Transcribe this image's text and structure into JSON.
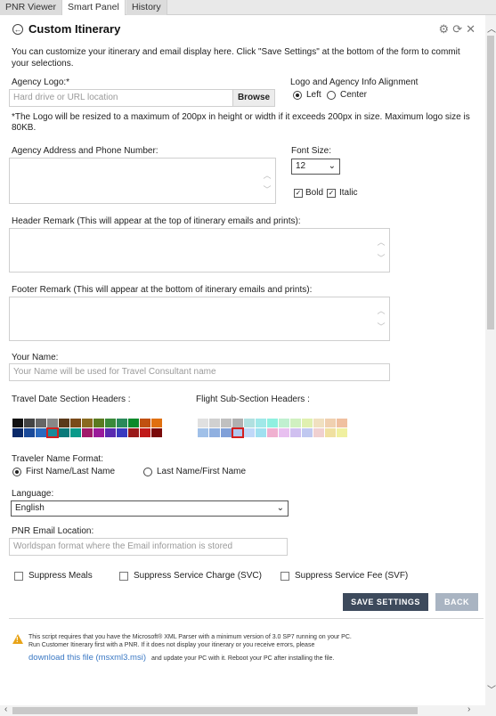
{
  "tabs": [
    "PNR Viewer",
    "Smart Panel",
    "History"
  ],
  "panel": {
    "title": "Custom Itinerary",
    "intro": "You can customize your itinerary and email display here. Click \"Save Settings\" at the bottom of the form to commit your selections."
  },
  "logo": {
    "label": "Agency Logo:*",
    "placeholder": "Hard drive or URL location",
    "browse": "Browse",
    "note": "*The Logo will be resized to a maximum of 200px in height or width if it exceeds 200px in size. Maximum logo size is 80KB."
  },
  "alignment": {
    "label": "Logo and Agency Info Alignment",
    "left": "Left",
    "center": "Center",
    "selected": "Left"
  },
  "address": {
    "label": "Agency Address and Phone Number:"
  },
  "font": {
    "label": "Font Size:",
    "value": "12",
    "bold": "Bold",
    "italic": "Italic"
  },
  "header_remark": {
    "label": "Header Remark (This will appear at the top of itinerary emails and prints):"
  },
  "footer_remark": {
    "label": "Footer Remark (This will appear at the bottom of itinerary emails and prints):"
  },
  "your_name": {
    "label": "Your Name:",
    "placeholder": "Your Name will be used for Travel Consultant name"
  },
  "palettes": {
    "travel_label": "Travel Date Section Headers :",
    "flight_label": "Flight Sub-Section Headers :",
    "travel_colors": [
      "#111111",
      "#444444",
      "#666666",
      "#888888",
      "#5a3a1a",
      "#7a4a1a",
      "#8a6a20",
      "#5a7a20",
      "#3a8a3a",
      "#2a8a5a",
      "#0a8a2a",
      "#c05010",
      "#e07010",
      "#0a2a6a",
      "#1a4a9a",
      "#2a6ac0",
      "#1a8a9a",
      "#0a7a7a",
      "#0a9a8a",
      "#a01a6a",
      "#9a1a9a",
      "#5a2ab0",
      "#3a3ac0",
      "#9a1a1a",
      "#c01a1a",
      "#7a0a0a"
    ],
    "flight_colors": [
      "#e0e0e0",
      "#d0d0d0",
      "#c0c0c0",
      "#b0b0b0",
      "#b0e0e0",
      "#a0e8e8",
      "#90f0e0",
      "#c0f0d0",
      "#d0f0c0",
      "#e0f0b0",
      "#f0e0c0",
      "#f0d0b0",
      "#f0c0a0",
      "#a0c0e8",
      "#90b0e0",
      "#80a0d8",
      "#b0c8f0",
      "#c0d8f8",
      "#a0e0f0",
      "#f0b0d0",
      "#e8c0f0",
      "#d0c0f0",
      "#c0c8f0",
      "#f0d0d0",
      "#f0e0a0",
      "#f0f0a0"
    ],
    "travel_selected_index": 16,
    "flight_selected_index": 16
  },
  "traveler": {
    "label": "Traveler Name Format:",
    "opt1": "First Name/Last Name",
    "opt2": "Last Name/First Name",
    "selected": "First Name/Last Name"
  },
  "language": {
    "label": "Language:",
    "value": "English"
  },
  "email": {
    "label": "PNR Email Location:",
    "placeholder": "Worldspan format where the Email information is stored"
  },
  "suppress": {
    "meals": "Suppress Meals",
    "svc": "Suppress Service Charge (SVC)",
    "svf": "Suppress Service Fee (SVF)"
  },
  "actions": {
    "save": "SAVE SETTINGS",
    "back": "BACK"
  },
  "footer": {
    "line1": "This script requires that you have the Microsoft® XML Parser with a minimum version of 3.0 SP7 running on your PC.",
    "line2": "Run Customer Itinerary first with a PNR.  If it does not display your itinerary or you receive errors, please",
    "link": "download this file (msxml3.msi)",
    "line3": "and update your PC with it. Reboot your PC after installing the file."
  }
}
